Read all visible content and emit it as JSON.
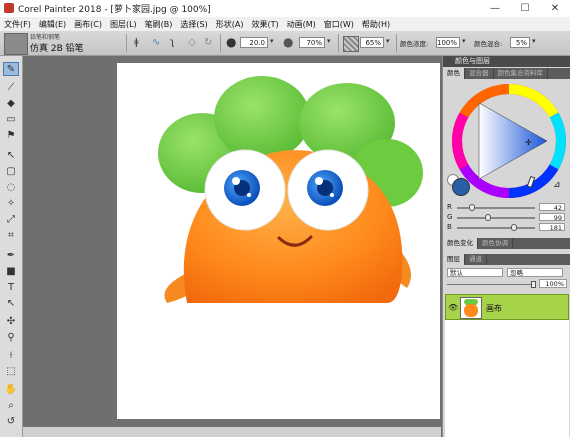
{
  "window": {
    "title": "Corel Painter 2018 - [萝卜家园.jpg @ 100%]",
    "minimize": "—",
    "maximize": "☐",
    "close": "✕"
  },
  "menu": [
    "文件(F)",
    "编辑(E)",
    "画布(C)",
    "图层(L)",
    "笔刷(B)",
    "选择(S)",
    "形状(A)",
    "效果(T)",
    "动画(M)",
    "窗口(W)",
    "帮助(H)"
  ],
  "property_bar": {
    "brush_category": "铅笔和钢笔",
    "brush_variant": "仿真 2B 铅笔",
    "size": "20.0",
    "opacity": "70%",
    "grain": "65%",
    "resat_label": "颜色浓度:",
    "resat_value": "100%",
    "bleed_label": "颜色混合:",
    "bleed_value": "5%"
  },
  "color_panel": {
    "header": "颜色与图层",
    "tabs": [
      "颜色",
      "混合器",
      "颜色集合资料库"
    ],
    "current_color": "#2a5fa8",
    "rgb": [
      {
        "label": "R",
        "value": "42"
      },
      {
        "label": "G",
        "value": "99"
      },
      {
        "label": "B",
        "value": "181"
      }
    ],
    "variation_tabs": [
      "颜色变化",
      "颜色协调"
    ]
  },
  "layers_panel": {
    "tabs": [
      "图层",
      "通道"
    ],
    "composite_method": "默认",
    "composite_depth": "忽略",
    "opacity": "100%",
    "layers": [
      {
        "name": "画布",
        "visible": true
      }
    ]
  },
  "document": {
    "zoom": "100%",
    "filename": "萝卜家园.jpg"
  }
}
